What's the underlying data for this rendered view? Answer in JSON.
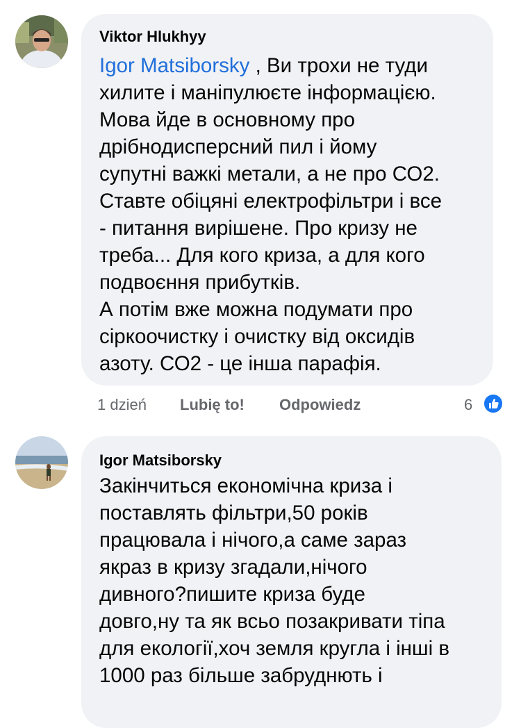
{
  "comments": [
    {
      "author": "Viktor Hlukhyy",
      "mention": "Igor Matsiborsky",
      "lines": [
        " , Ви трохи не туди",
        "хилите і маніпулюєте інформацією.",
        "Мова йде в основному про",
        "дрібнодисперсний пил і йому",
        "супутні важкі метали, а не про СО2.",
        "Ставте обіцяні електрофільтри і все",
        "- питання вирішене. Про кризу не",
        "треба... Для кого криза, а для кого",
        "подвоєння прибутків.",
        "А потім вже можна подумати про",
        "сіркоочистку і очистку від оксидів",
        "азоту. СО2 - це інша парафія."
      ],
      "time": "1 dzień",
      "like_label": "Lubię to!",
      "reply_label": "Odpowiedz",
      "reaction_count": "6",
      "reaction_icon": "thumbs-up-icon",
      "avatar_icon": "avatar-man-icon"
    },
    {
      "author": "Igor Matsiborsky",
      "lines": [
        "Закінчиться економічна криза і",
        "поставлять фільтри,50 років",
        "працювала і нічого,а саме зараз",
        "якраз в кризу згадали,нічого",
        "дивного?пишите криза буде",
        "довго,ну та як всьо позакривати тіпа",
        "для екології,хоч земля кругла і інші в",
        "1000 раз більше забруднють і"
      ],
      "avatar_icon": "avatar-beach-icon"
    }
  ],
  "colors": {
    "bubble": "#f0f2f5",
    "mention": "#216fdb",
    "meta": "#65676b",
    "like_badge": "#1877f2"
  }
}
